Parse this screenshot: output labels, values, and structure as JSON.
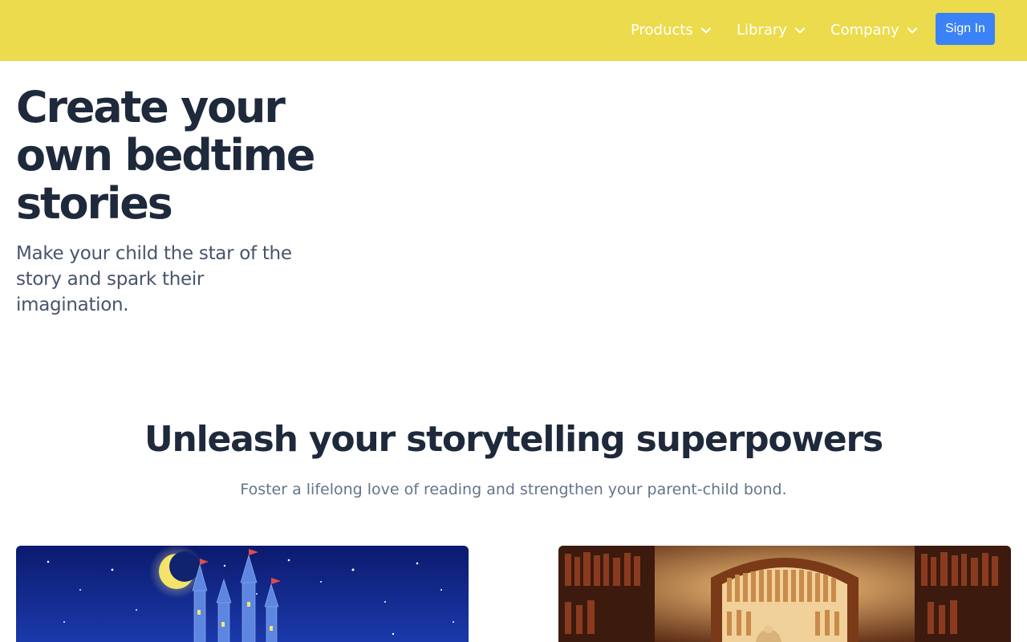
{
  "header": {
    "nav": [
      {
        "label": "Products"
      },
      {
        "label": "Library"
      },
      {
        "label": "Company"
      }
    ],
    "sign_in_label": "Sign In",
    "accent_color": "#ecdb4c",
    "button_color": "#3b82f6"
  },
  "hero": {
    "title": "Create your own bedtime stories",
    "subtitle": "Make your child the star of the story and spark their imagination."
  },
  "features": {
    "title": "Unleash your storytelling superpowers",
    "subtitle": "Foster a lifelong love of reading and strengthen your parent-child bond.",
    "cards": [
      {
        "image": "night-castle-moon-illustration"
      },
      {
        "image": "library-bookshelves-illustration"
      }
    ]
  }
}
